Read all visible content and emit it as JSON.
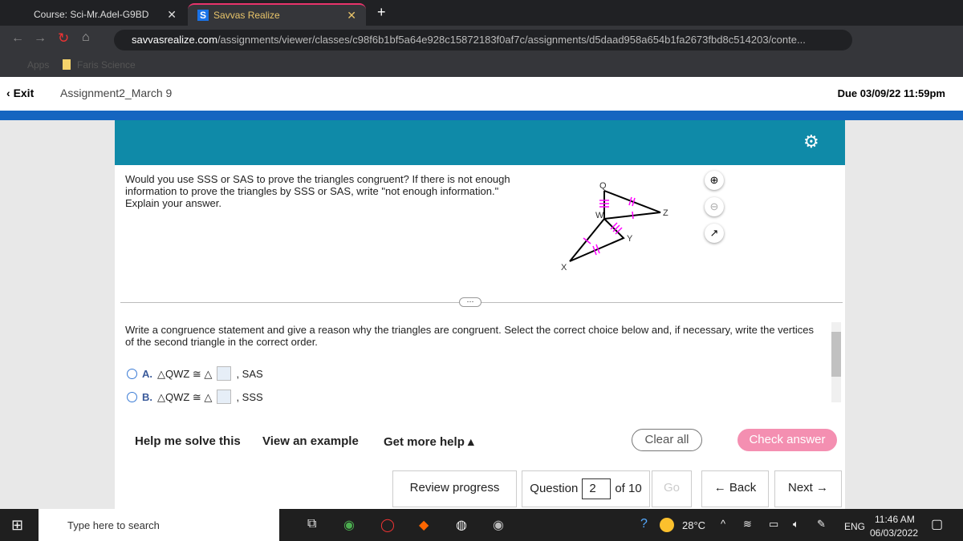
{
  "browser": {
    "tabs": [
      {
        "label": "Course: Sci-Mr.Adel-G9BD"
      },
      {
        "label": "Savvas Realize"
      }
    ],
    "url_domain": "savvasrealize.com",
    "url_path": "/assignments/viewer/classes/c98f6b1bf5a64e928c15872183f0af7c/assignments/d5daad958a654b1fa2673fbd8c514203/conte...",
    "bookmarks": [
      "Apps",
      "Faris Science"
    ]
  },
  "header": {
    "exit": "Exit",
    "title": "Assignment2_March 9",
    "due": "Due 03/09/22 11:59pm"
  },
  "question": {
    "text": "Would you use SSS or SAS to prove the triangles congruent? If there is not enough information to prove the triangles by SSS or SAS, write \"not enough information.\" Explain your answer.",
    "labels": {
      "Q": "Q",
      "W": "W",
      "Z": "Z",
      "Y": "Y",
      "X": "X"
    },
    "instruction": "Write a congruence statement and give a reason why the triangles are congruent. Select the correct choice below and, if necessary, write the vertices of the second triangle in the correct order.",
    "choices": [
      {
        "letter": "A.",
        "prefix": "△QWZ ≅ △",
        "suffix": ", SAS"
      },
      {
        "letter": "B.",
        "prefix": "△QWZ ≅ △",
        "suffix": ", SSS"
      }
    ]
  },
  "actions": {
    "help": "Help me solve this",
    "example": "View an example",
    "more": "Get more help ▴",
    "clear": "Clear all",
    "check": "Check answer"
  },
  "footer": {
    "review": "Review progress",
    "question_label": "Question",
    "question_value": "2",
    "of": "of 10",
    "go": "Go",
    "back": "Back",
    "next": "Next"
  },
  "taskbar": {
    "search": "Type here to search",
    "temp": "28°C",
    "lang": "ENG",
    "time": "11:46 AM",
    "date": "06/03/2022"
  },
  "colors": {
    "teal": "#0f8aa8",
    "accent": "#1565c0",
    "check": "#f48fb1",
    "mark": "#ff00ff"
  }
}
